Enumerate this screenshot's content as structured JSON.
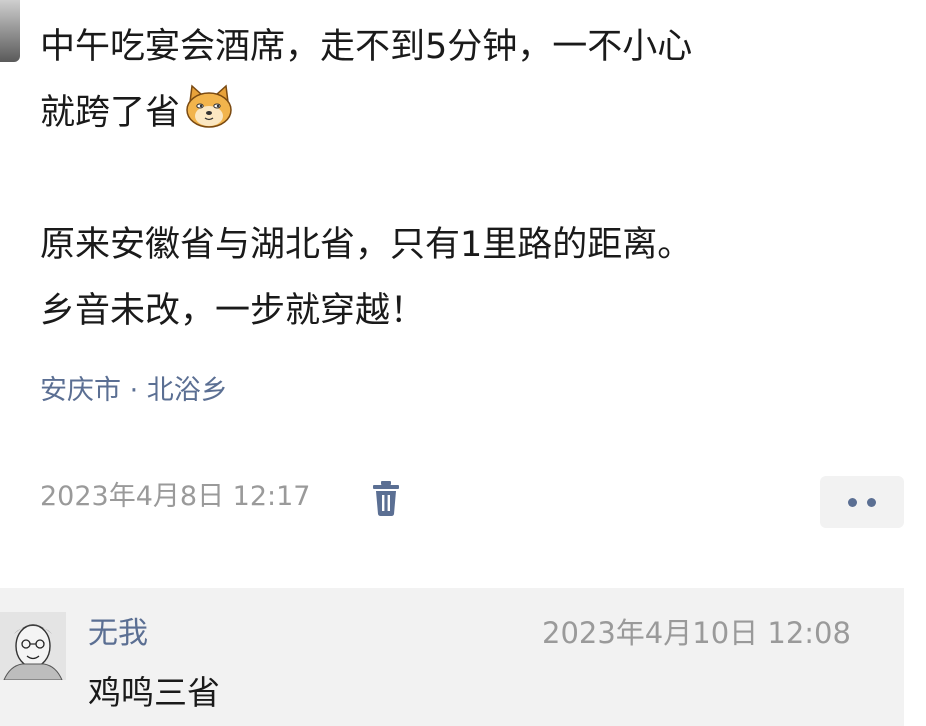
{
  "post": {
    "line1": "中午吃宴会酒席，走不到5分钟，一不小心",
    "line2": "就跨了省",
    "line3": "原来安徽省与湖北省，只有1里路的距离。",
    "line4": "乡音未改，一步就穿越！",
    "emoji": "doge-emoji",
    "location": "安庆市 · 北浴乡",
    "timestamp": "2023年4月8日 12:17"
  },
  "actions": {
    "delete_icon": "trash-icon",
    "more_icon": "more-dots-icon"
  },
  "comment": {
    "author": "无我",
    "time": "2023年4月10日 12:08",
    "text": "鸡鸣三省"
  },
  "colors": {
    "link": "#5b6f93",
    "meta": "#9a9a9a",
    "text": "#1a1a1a",
    "comment_bg": "#f2f2f2"
  }
}
